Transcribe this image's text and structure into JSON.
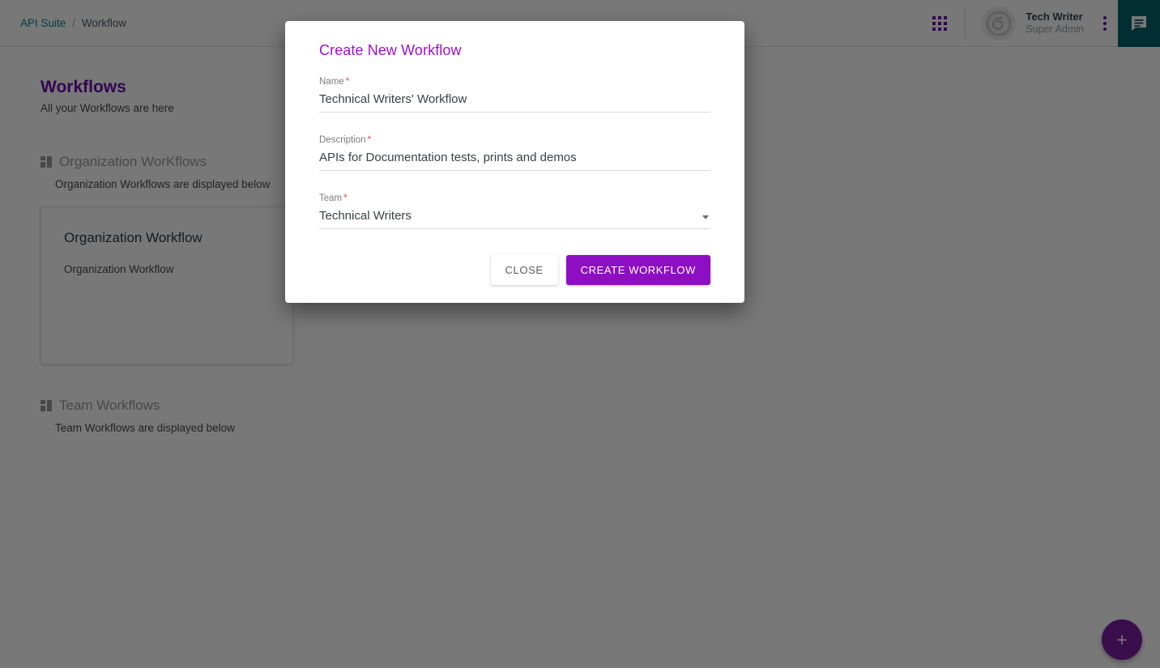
{
  "header": {
    "breadcrumb": {
      "root": "API Suite",
      "separator": "/",
      "current": "Workflow"
    },
    "apps_icon": "apps-grid-icon",
    "avatar_icon": "brand-logo-icon",
    "user": {
      "name": "Tech Writer",
      "role": "Super Admin"
    },
    "kebab_icon": "more-vertical-icon",
    "chat_icon": "chat-bubble-icon"
  },
  "page": {
    "title": "Workflows",
    "subtitle": "All your Workflows are here",
    "sections": [
      {
        "icon": "dashboard-icon",
        "title": "Organization WorKflows",
        "subtitle": "Organization Workflows are displayed below"
      },
      {
        "icon": "dashboard-icon",
        "title": "Team Workflows",
        "subtitle": "Team Workflows are displayed below"
      }
    ],
    "card": {
      "title": "Organization Workflow",
      "subtitle": "Organization Workflow"
    },
    "fab_label": "+"
  },
  "modal": {
    "title": "Create New Workflow",
    "required_marker": "*",
    "fields": [
      {
        "label": "Name",
        "value": "Technical Writers' Workflow",
        "placeholder": "Name"
      },
      {
        "label": "Description",
        "value": "APIs for Documentation tests, prints and demos",
        "placeholder": "Description"
      },
      {
        "label": "Team",
        "value": "Technical Writers",
        "placeholder": "Team"
      }
    ],
    "close_label": "CLOSE",
    "create_label": "CREATE WORKFLOW"
  },
  "colors": {
    "accent_purple": "#6a0dad",
    "modal_title_purple": "#9c0fd4",
    "create_button_purple": "#8e0ec4",
    "teal_link": "#00838f",
    "teal_chat": "#00636e",
    "required_red": "#f44336"
  }
}
